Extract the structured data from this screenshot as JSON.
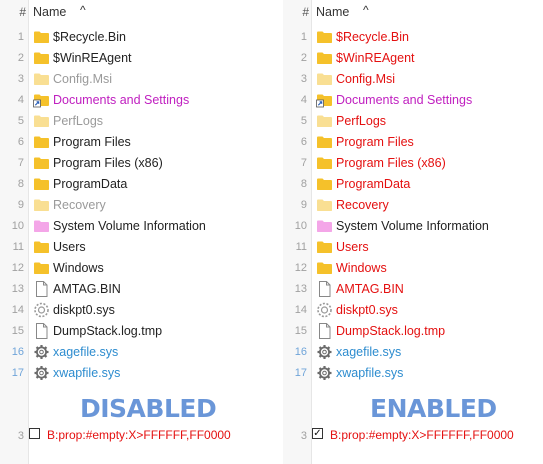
{
  "header": {
    "hash": "#",
    "name": "Name",
    "sort_glyph": "^"
  },
  "files": [
    {
      "num": "1",
      "name": "$Recycle.Bin",
      "icon": "folder-icon",
      "style": "normal",
      "hidden": false
    },
    {
      "num": "2",
      "name": "$WinREAgent",
      "icon": "folder-icon",
      "style": "normal",
      "hidden": false
    },
    {
      "num": "3",
      "name": "Config.Msi",
      "icon": "folder-icon",
      "style": "hidden",
      "hidden": true
    },
    {
      "num": "4",
      "name": "Documents and Settings",
      "icon": "folder-link-icon",
      "style": "junction",
      "hidden": false
    },
    {
      "num": "5",
      "name": "PerfLogs",
      "icon": "folder-icon",
      "style": "hidden",
      "hidden": true
    },
    {
      "num": "6",
      "name": "Program Files",
      "icon": "folder-icon",
      "style": "normal",
      "hidden": false
    },
    {
      "num": "7",
      "name": "Program Files (x86)",
      "icon": "folder-icon",
      "style": "normal",
      "hidden": false
    },
    {
      "num": "8",
      "name": "ProgramData",
      "icon": "folder-icon",
      "style": "normal",
      "hidden": false
    },
    {
      "num": "9",
      "name": "Recovery",
      "icon": "folder-icon",
      "style": "hidden",
      "hidden": true
    },
    {
      "num": "10",
      "name": "System Volume Information",
      "icon": "system-folder-icon",
      "style": "normal",
      "hidden": false
    },
    {
      "num": "11",
      "name": "Users",
      "icon": "folder-icon",
      "style": "normal",
      "hidden": false
    },
    {
      "num": "12",
      "name": "Windows",
      "icon": "folder-icon",
      "style": "normal",
      "hidden": false
    },
    {
      "num": "13",
      "name": "AMTAG.BIN",
      "icon": "file-icon",
      "style": "normal",
      "hidden": false
    },
    {
      "num": "14",
      "name": "diskpt0.sys",
      "icon": "gear-file-icon",
      "style": "normal",
      "hidden": false
    },
    {
      "num": "15",
      "name": "DumpStack.log.tmp",
      "icon": "file-icon",
      "style": "normal",
      "hidden": false
    },
    {
      "num": "16",
      "name": "xagefile.sys",
      "icon": "gear-file-icon",
      "style": "compressed",
      "hidden": false
    },
    {
      "num": "17",
      "name": "xwapfile.sys",
      "icon": "gear-file-icon",
      "style": "compressed",
      "hidden": false
    }
  ],
  "labels": {
    "disabled": "DISABLED",
    "enabled": "ENABLED"
  },
  "filter": {
    "line": "3",
    "text": "B:prop:#empty:X>FFFFFF,FF0000",
    "left_checked": false,
    "right_checked": true
  },
  "colors": {
    "normal": "#222222",
    "hidden": "#9a9a9a",
    "compressed": "#2d8ccf",
    "junction": "#c020c0",
    "highlight": "#e41010",
    "folder": "#f5c12a",
    "label": "#6a96d8"
  }
}
